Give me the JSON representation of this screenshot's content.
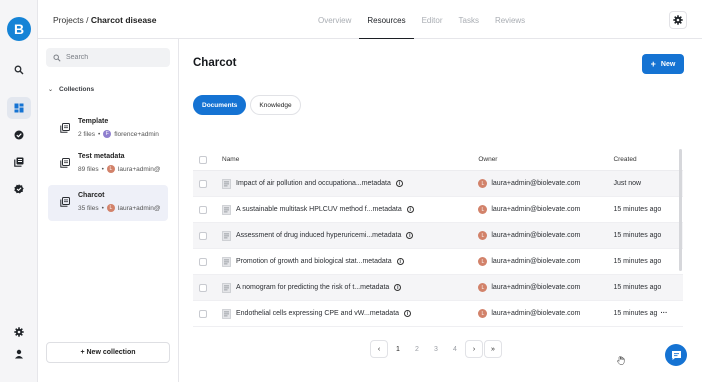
{
  "app": {
    "logo_letter": "B",
    "accent": "#1573d3",
    "brand": "#1583d6"
  },
  "rail": {
    "items": [
      {
        "icon": "search-icon"
      },
      {
        "icon": "collections-icon",
        "active": true
      },
      {
        "icon": "check-circle-icon"
      },
      {
        "icon": "library-icon"
      },
      {
        "icon": "badge-check-icon"
      },
      {
        "icon": "gear-icon"
      },
      {
        "icon": "user-icon"
      }
    ]
  },
  "header": {
    "breadcrumb_root": "Projects",
    "breadcrumb_sep": "/",
    "breadcrumb_current": "Charcot disease",
    "tabs": [
      {
        "label": "Overview",
        "active": false
      },
      {
        "label": "Resources",
        "active": true
      },
      {
        "label": "Editor",
        "active": false
      },
      {
        "label": "Tasks",
        "active": false
      },
      {
        "label": "Reviews",
        "active": false
      }
    ]
  },
  "sidebar": {
    "search_placeholder": "Search",
    "section_label": "Collections",
    "collections": [
      {
        "name": "Template",
        "files": "2 files",
        "owner_initial": "F",
        "owner": "florence+admin",
        "owner_color": "#8f7fcf",
        "active": false
      },
      {
        "name": "Test metadata",
        "files": "89 files",
        "owner_initial": "L",
        "owner": "laura+admin@",
        "owner_color": "#d2826a",
        "active": false
      },
      {
        "name": "Charcot",
        "files": "35 files",
        "owner_initial": "L",
        "owner": "laura+admin@",
        "owner_color": "#d2826a",
        "active": true
      }
    ],
    "new_collection_label": "+ New collection"
  },
  "main": {
    "title": "Charcot",
    "new_button_label": "New",
    "pills": [
      {
        "label": "Documents",
        "active": true
      },
      {
        "label": "Knowledge",
        "active": false
      }
    ],
    "table": {
      "headers": {
        "name": "Name",
        "owner": "Owner",
        "created": "Created"
      },
      "rows": [
        {
          "name": "Impact of air pollution and occupationa...metadata",
          "owner_initial": "L",
          "owner": "laura+admin@biolevate.com",
          "created": "Just now"
        },
        {
          "name": "A sustainable multitask HPLCUV method f...metadata",
          "owner_initial": "L",
          "owner": "laura+admin@biolevate.com",
          "created": "15 minutes ago"
        },
        {
          "name": "Assessment of drug induced hyperuricemi...metadata",
          "owner_initial": "L",
          "owner": "laura+admin@biolevate.com",
          "created": "15 minutes ago"
        },
        {
          "name": "Promotion of growth and biological stat...metadata",
          "owner_initial": "L",
          "owner": "laura+admin@biolevate.com",
          "created": "15 minutes ago"
        },
        {
          "name": "A nomogram for predicting the risk of t...metadata",
          "owner_initial": "L",
          "owner": "laura+admin@biolevate.com",
          "created": "15 minutes ago"
        },
        {
          "name": "Endothelial cells expressing CPE and vW...metadata",
          "owner_initial": "L",
          "owner": "laura+admin@biolevate.com",
          "created": "15 minutes ag"
        }
      ]
    },
    "pagination": {
      "pages": [
        "1",
        "2",
        "3",
        "4"
      ],
      "current": "1"
    }
  }
}
